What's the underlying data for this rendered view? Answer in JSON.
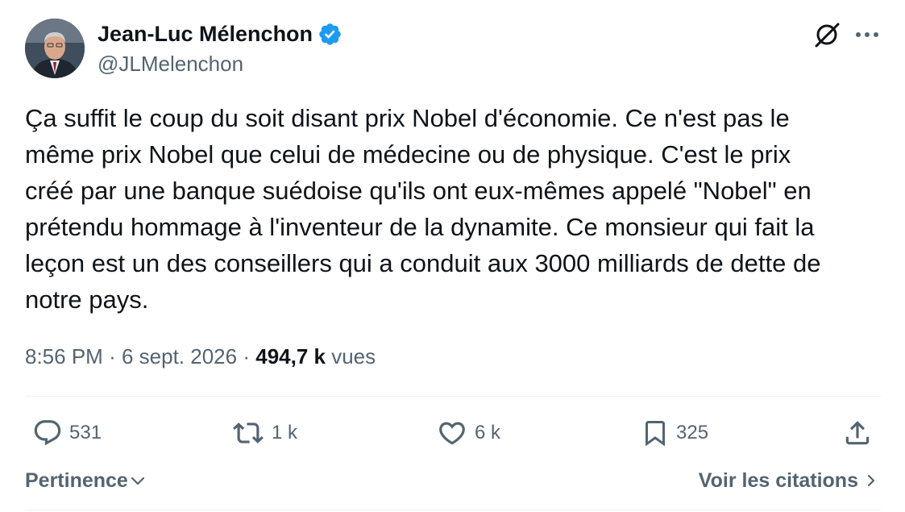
{
  "author": {
    "name": "Jean-Luc Mélenchon",
    "handle": "@JLMelenchon",
    "verified_color": "#1d9bf0"
  },
  "tweet": {
    "lines": [
      "Ça suffit le coup du soit disant prix Nobel d'économie. Ce n'est pas le",
      "même prix Nobel que celui de médecine ou de physique. C'est le prix",
      "créé par une banque suédoise qu'ils ont eux-mêmes appelé \"Nobel\" en",
      "prétendu hommage à l'inventeur de la dynamite. Ce monsieur qui fait la",
      "leçon est un des conseillers qui a conduit aux 3000 milliards de dette de",
      "notre pays."
    ],
    "time": "8:56 PM",
    "separator": "·",
    "date": "6 sept. 2026",
    "views_count": "494,7 k",
    "views_label": "vues"
  },
  "actions": {
    "replies": "531",
    "retweets": "1 k",
    "likes": "6 k",
    "bookmarks": "325"
  },
  "footer": {
    "sort_label": "Pertinence",
    "quotes_label": "Voir les citations"
  },
  "icons": {
    "grok": "grok-icon",
    "more": "more-horizontal-icon",
    "reply": "reply-icon",
    "retweet": "retweet-icon",
    "like": "heart-icon",
    "bookmark": "bookmark-icon",
    "share": "share-icon"
  },
  "colors": {
    "text": "#0f1419",
    "secondary": "#536471",
    "divider": "#eff3f4"
  }
}
